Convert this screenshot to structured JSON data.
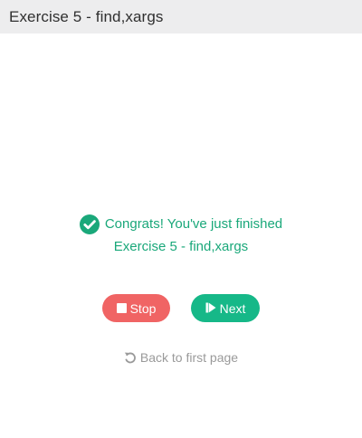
{
  "window": {
    "title": "Exercise 5 - find,xargs"
  },
  "main": {
    "congrats_line1": "Congrats! You've just finished",
    "congrats_line2": "Exercise 5 - find,xargs",
    "stop_label": "Stop",
    "next_label": "Next",
    "back_label": "Back to first page"
  },
  "icons": {
    "check": "check-circle-icon",
    "stop": "stop-icon",
    "next": "step-forward-icon",
    "back": "undo-icon"
  },
  "colors": {
    "accent_green": "#1aa87a",
    "stop_red": "#f06464",
    "next_green": "#16b888",
    "muted_gray": "#9a9a9a",
    "titlebar_bg": "#ededee"
  }
}
